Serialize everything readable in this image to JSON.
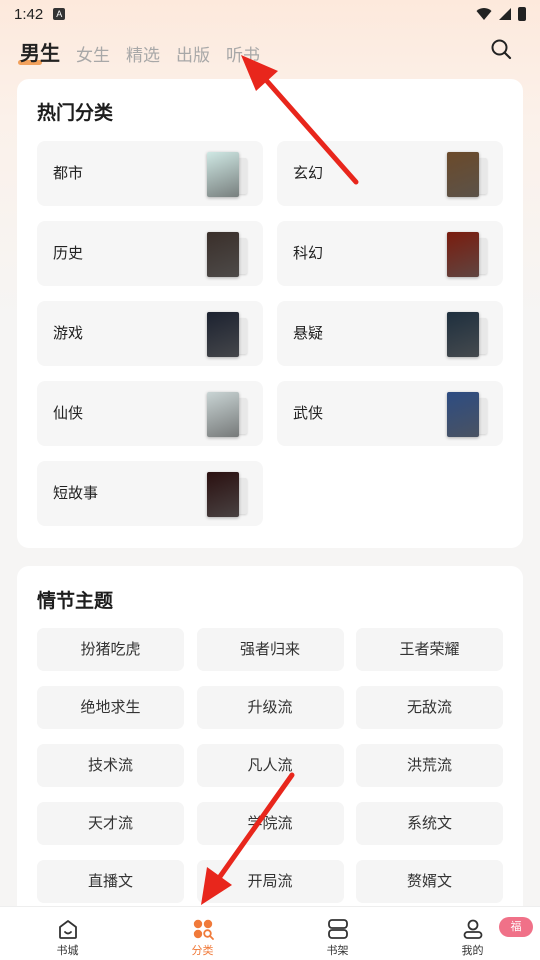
{
  "status_bar": {
    "time": "1:42",
    "app_icon_glyph": "A"
  },
  "top_tabs": [
    {
      "label": "男生",
      "active": true
    },
    {
      "label": "女生"
    },
    {
      "label": "精选"
    },
    {
      "label": "出版"
    },
    {
      "label": "听书"
    }
  ],
  "search_icon": "search-icon",
  "hot_categories": {
    "title": "热门分类",
    "items": [
      {
        "label": "都市",
        "cover_color": "#cfe8e4"
      },
      {
        "label": "玄幻",
        "cover_color": "#6b4a2a"
      },
      {
        "label": "历史",
        "cover_color": "#3a2f2a"
      },
      {
        "label": "科幻",
        "cover_color": "#7a1c0e"
      },
      {
        "label": "游戏",
        "cover_color": "#1c2230"
      },
      {
        "label": "悬疑",
        "cover_color": "#1e2f3e"
      },
      {
        "label": "仙侠",
        "cover_color": "#c9d4d4"
      },
      {
        "label": "武侠",
        "cover_color": "#2d4c82"
      },
      {
        "label": "短故事",
        "cover_color": "#2a1010"
      }
    ]
  },
  "plot_themes": {
    "title": "情节主题",
    "items": [
      "扮猪吃虎",
      "强者归来",
      "王者荣耀",
      "绝地求生",
      "升级流",
      "无敌流",
      "技术流",
      "凡人流",
      "洪荒流",
      "天才流",
      "学院流",
      "系统文",
      "直播文",
      "开局流",
      "赘婿文"
    ]
  },
  "bottom_nav": {
    "items": [
      {
        "label": "书城",
        "icon": "home-icon"
      },
      {
        "label": "分类",
        "icon": "category-icon",
        "active": true
      },
      {
        "label": "书架",
        "icon": "bookshelf-icon"
      },
      {
        "label": "我的",
        "icon": "profile-icon"
      }
    ],
    "badge": "福"
  },
  "colors": {
    "accent": "#f07a3a",
    "annotation_arrow": "#e8261c",
    "badge": "#f07188"
  }
}
